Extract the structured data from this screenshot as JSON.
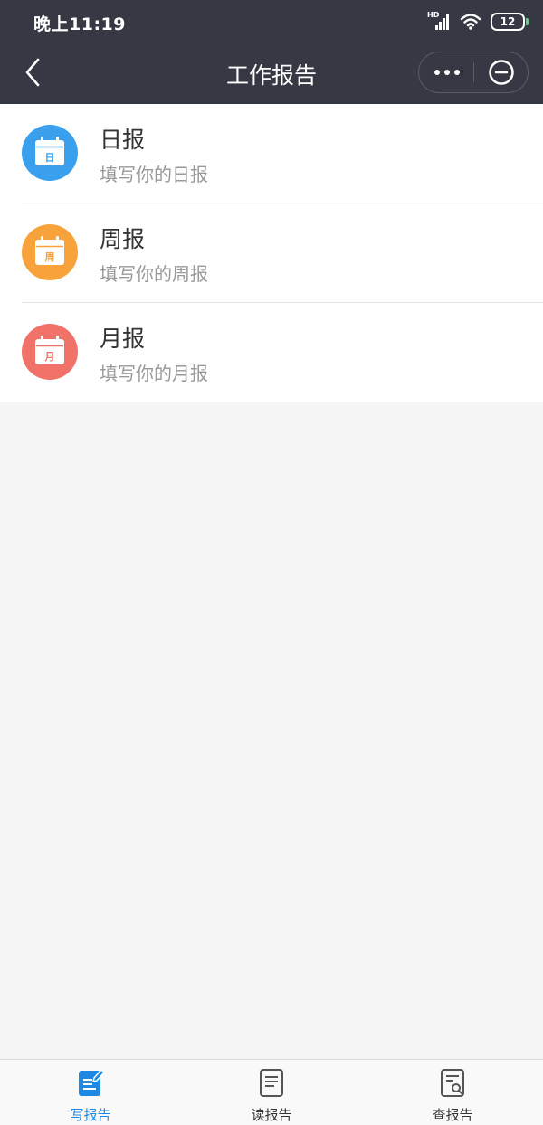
{
  "status_bar": {
    "time": "晚上11:19",
    "network": "HD",
    "battery": "12"
  },
  "nav": {
    "title": "工作报告"
  },
  "reports": [
    {
      "title": "日报",
      "subtitle": "填写你的日报",
      "icon_char": "日",
      "color": "#3aa0ee"
    },
    {
      "title": "周报",
      "subtitle": "填写你的周报",
      "icon_char": "周",
      "color": "#f7a23b"
    },
    {
      "title": "月报",
      "subtitle": "填写你的月报",
      "icon_char": "月",
      "color": "#f07269"
    }
  ],
  "tabs": [
    {
      "label": "写报告",
      "active": true
    },
    {
      "label": "读报告",
      "active": false
    },
    {
      "label": "查报告",
      "active": false
    }
  ],
  "colors": {
    "header_bg": "#363843",
    "active_tab": "#1e88e5",
    "page_bg": "#f5f5f5"
  }
}
